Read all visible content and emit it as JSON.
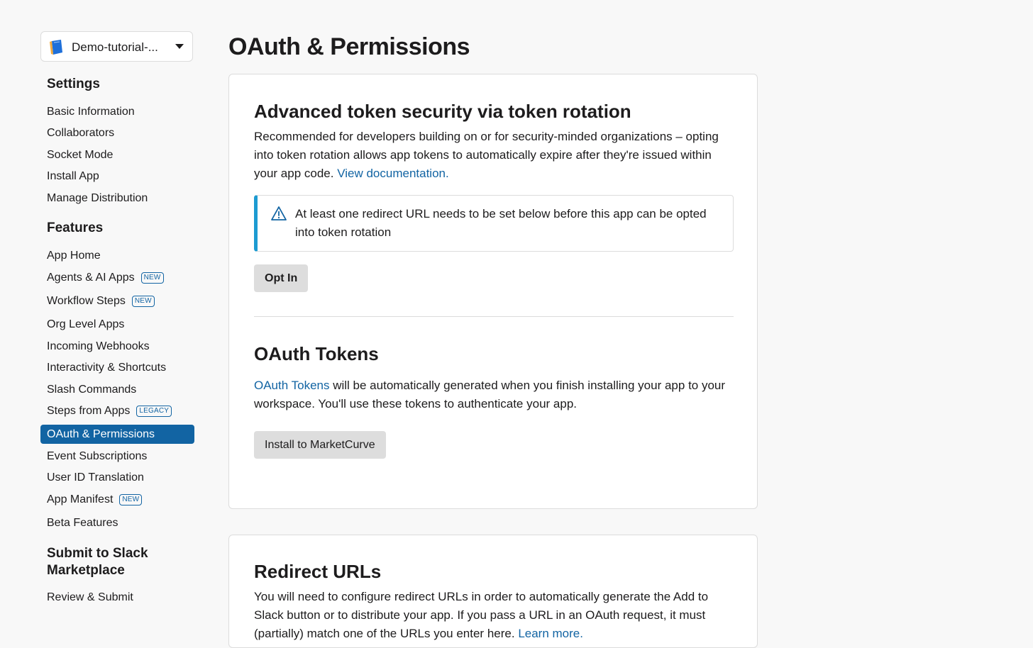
{
  "app_picker": {
    "name": "Demo-tutorial-..."
  },
  "sidebar": {
    "settings_heading": "Settings",
    "settings_items": [
      "Basic Information",
      "Collaborators",
      "Socket Mode",
      "Install App",
      "Manage Distribution"
    ],
    "features_heading": "Features",
    "features_items": [
      {
        "label": "App Home"
      },
      {
        "label": "Agents & AI Apps",
        "badge": "NEW"
      },
      {
        "label": "Workflow Steps",
        "badge": "NEW"
      },
      {
        "label": "Org Level Apps"
      },
      {
        "label": "Incoming Webhooks"
      },
      {
        "label": "Interactivity & Shortcuts"
      },
      {
        "label": "Slash Commands"
      },
      {
        "label": "Steps from Apps",
        "badge": "LEGACY"
      },
      {
        "label": "OAuth & Permissions",
        "active": true
      },
      {
        "label": "Event Subscriptions"
      },
      {
        "label": "User ID Translation"
      },
      {
        "label": "App Manifest",
        "badge": "NEW"
      },
      {
        "label": "Beta Features"
      }
    ],
    "submit_heading_line1": "Submit to Slack",
    "submit_heading_line2": "Marketplace",
    "submit_items": [
      "Review & Submit"
    ]
  },
  "main": {
    "title": "OAuth & Permissions",
    "token_rotation": {
      "heading": "Advanced token security via token rotation",
      "description": "Recommended for developers building on or for security-minded organizations – opting into token rotation allows app tokens to automatically expire after they're issued within your app code.",
      "doc_link": "View documentation.",
      "alert_text": "At least one redirect URL needs to be set below before this app can be opted into token rotation",
      "opt_in_button": "Opt In"
    },
    "oauth_tokens": {
      "heading": "OAuth Tokens",
      "link_text": "OAuth Tokens",
      "description": "will be automatically generated when you finish installing your app to your workspace. You'll use these tokens to authenticate your app.",
      "install_button": "Install to MarketCurve"
    },
    "redirect_urls": {
      "heading": "Redirect URLs",
      "description": "You will need to configure redirect URLs in order to automatically generate the Add to Slack button or to distribute your app. If you pass a URL in an OAuth request, it must (partially) match one of the URLs you enter here.",
      "learn_more": "Learn more."
    }
  },
  "colors": {
    "accent": "#1264a3",
    "alert_bar": "#1d9bd1",
    "background": "#f8f8f8"
  }
}
